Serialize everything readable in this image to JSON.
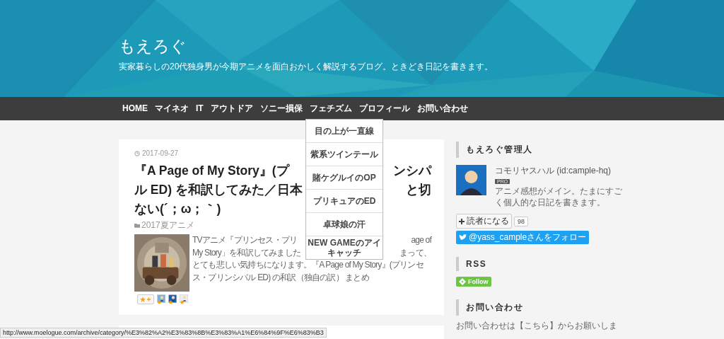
{
  "site": {
    "title": "もえろぐ",
    "tagline": "実家暮らしの20代独身男が今期アニメを面白おかしく解説するブログ。ときどき日記を書きます。"
  },
  "nav": [
    {
      "label": "HOME"
    },
    {
      "label": "マイネオ"
    },
    {
      "label": "IT"
    },
    {
      "label": "アウトドア"
    },
    {
      "label": "ソニー損保"
    },
    {
      "label": "フェチズム",
      "children": [
        "目の上が一直線",
        "紫系ツインテール",
        "賭ケグルイのOP",
        "プリキュアのED",
        "卓球娘の汗",
        "NEW GAMEのアイキャッチ"
      ]
    },
    {
      "label": "プロフィール"
    },
    {
      "label": "お問い合わせ"
    }
  ],
  "post": {
    "date": "2017-09-27",
    "title_lines": [
      {
        "left": "『A Page of My Story』(プ",
        "right": "ンシパ"
      },
      {
        "left": "ル ED) を和訳してみた／日本",
        "right": "と切"
      },
      {
        "left": "ない(´；ω；｀)"
      }
    ],
    "category": "2017夏アニメ",
    "excerpt_lines": [
      {
        "left": "TVアニメ『プリンセス・プリ",
        "right": "age of"
      },
      {
        "left": "My Story」を和訳してみました",
        "right": "まって、"
      },
      {
        "left": "とても悲しい気持ちになります。『A Page of My Story』(プリンセ"
      },
      {
        "left": "ス・プリンシパル ED) の和訳（独自の訳） まとめ"
      }
    ],
    "star_users": [
      {
        "color": "#7ab0d8"
      },
      {
        "color": "#1d5fa8"
      },
      {
        "color": "#eeeeee"
      }
    ]
  },
  "sidebar": {
    "profile": {
      "heading": "もえろぐ管理人",
      "name": "コモリヤスハル (id:cample-hq)",
      "badge": "PRO",
      "description": "アニメ感想がメイン。たまにすごく個人的な日記を書きます。",
      "subscribe": "読者になる",
      "count": "98",
      "twitter": "@yass_campleさんをフォロー"
    },
    "rss": {
      "heading": "RSS",
      "button": "Follow"
    },
    "contact": {
      "heading": "お問い合わせ",
      "text": "お問い合わせは【こちら】からお願いしま"
    }
  },
  "status_url": "http://www.moelogue.com/archive/category/%E3%82%A2%E3%83%8B%E3%83%A1%E6%84%9F%E6%83%B3"
}
